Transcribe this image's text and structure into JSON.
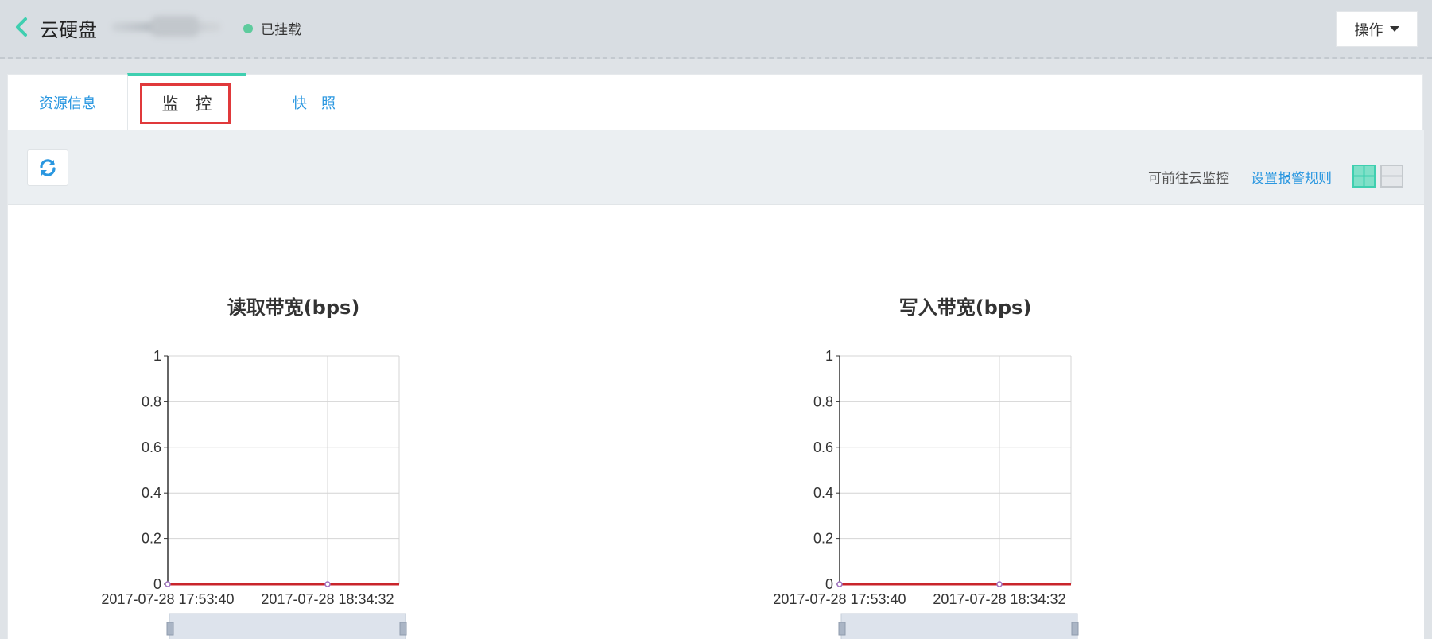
{
  "header": {
    "title": "云硬盘",
    "status": "已挂载",
    "actions_label": "操作"
  },
  "tabs": [
    {
      "label": "资源信息",
      "active": false
    },
    {
      "label": "监　控",
      "active": true
    },
    {
      "label": "快　照",
      "active": false
    }
  ],
  "toolbar": {
    "goto_monitor": "可前往云监控",
    "alert_rules": "设置报警规则"
  },
  "colors": {
    "accent": "#3fcfb0",
    "link": "#2a97e0",
    "status_ok": "#5ecb9d",
    "series_line": "#c9252b",
    "highlight_box": "#e0393b"
  },
  "chart_data": [
    {
      "type": "line",
      "title": "读取带宽(bps)",
      "x": [
        "2017-07-28 17:53:40",
        "2017-07-28 18:34:32"
      ],
      "series": [
        {
          "values": [
            0,
            0
          ]
        }
      ],
      "y_ticks": [
        "0",
        "0.2",
        "0.4",
        "0.6",
        "0.8",
        "1"
      ],
      "ylim": [
        0,
        1
      ],
      "grid": true
    },
    {
      "type": "line",
      "title": "写入带宽(bps)",
      "x": [
        "2017-07-28 17:53:40",
        "2017-07-28 18:34:32"
      ],
      "series": [
        {
          "values": [
            0,
            0
          ]
        }
      ],
      "y_ticks": [
        "0",
        "0.2",
        "0.4",
        "0.6",
        "0.8",
        "1"
      ],
      "ylim": [
        0,
        1
      ],
      "grid": true
    }
  ]
}
